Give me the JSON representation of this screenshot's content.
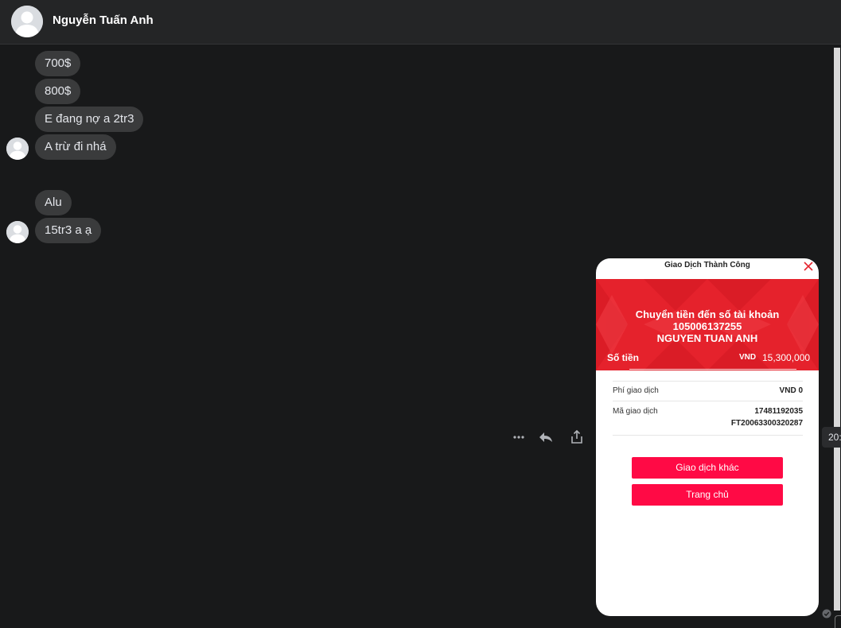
{
  "header": {
    "contact_name": "Nguyễn Tuấn Anh"
  },
  "messages": [
    {
      "text": "700$"
    },
    {
      "text": "800$"
    },
    {
      "text": "E đang nợ a 2tr3"
    },
    {
      "text": "A trừ đi nhá"
    },
    {
      "text": "Alu"
    },
    {
      "text": "15tr3 a ạ"
    }
  ],
  "message_actions": {
    "more_icon": "more-horizontal-icon",
    "reply_icon": "reply-icon",
    "share_icon": "share-icon",
    "time_partial": "20:"
  },
  "receipt": {
    "title": "Giao Dịch Thành Công",
    "headline": "Chuyển tiền đến số tài khoản",
    "account_number": "105006137255",
    "account_name": "NGUYEN TUAN ANH",
    "amount_label": "Số tiền",
    "amount_currency": "VND",
    "amount_value": "15,300,000",
    "fee_label": "Phí giao dịch",
    "fee_value": "VND 0",
    "code_label": "Mã giao dịch",
    "code_value_1": "17481192035",
    "code_value_2": "FT20063300320287",
    "button_other": "Giao dịch khác",
    "button_home": "Trang chủ"
  },
  "colors": {
    "background": "#18191a",
    "bubble": "#3a3b3c",
    "banner_red": "#e5222c",
    "button_red": "#ff0a45"
  }
}
